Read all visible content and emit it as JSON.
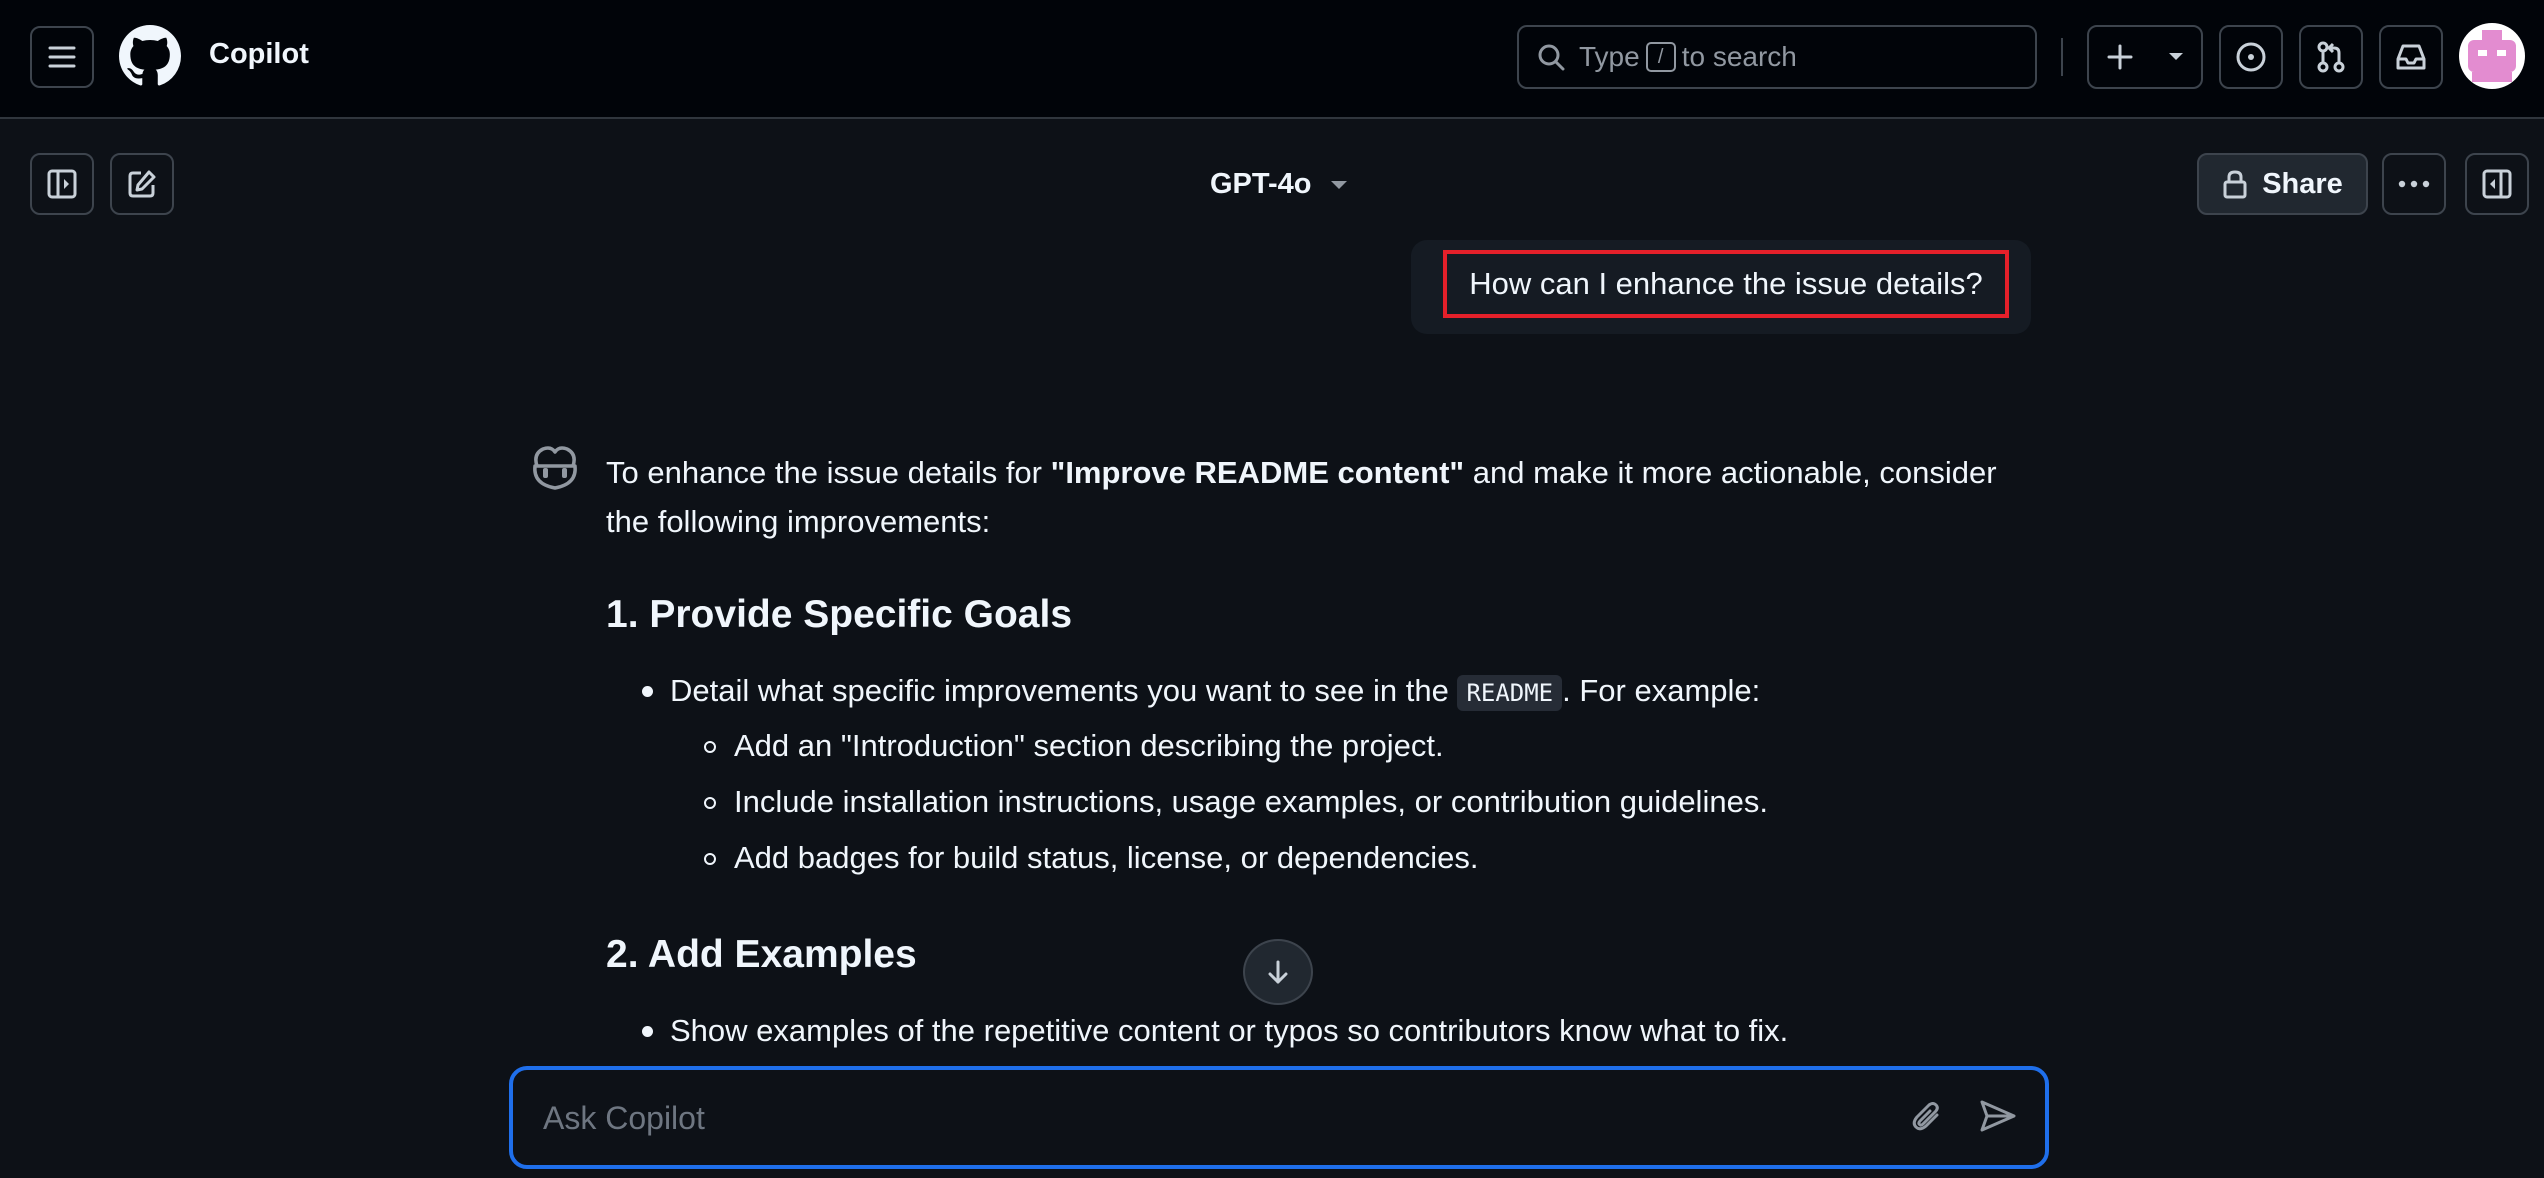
{
  "header": {
    "app_title": "Copilot",
    "search": {
      "prefix": "Type",
      "key_hint": "/",
      "suffix": "to search"
    },
    "icons": [
      "hamburger-icon",
      "github-logo",
      "search-icon",
      "plus-icon",
      "chevron-down-icon",
      "issue-opened-icon",
      "pull-request-icon",
      "inbox-icon",
      "avatar"
    ]
  },
  "toolbar": {
    "model": "GPT-4o",
    "share_label": "Share",
    "icons": [
      "sidebar-expand-icon",
      "new-chat-icon",
      "triangle-down-icon",
      "lock-icon",
      "kebab-horizontal-icon",
      "sidebar-collapse-icon"
    ]
  },
  "conversation": {
    "user_message": "How can I enhance the issue details?",
    "answer": {
      "intro_before": "To enhance the issue details for ",
      "intro_bold": "\"Improve README content\"",
      "intro_after": " and make it more actionable, consider the following improvements:",
      "section1_heading": "1. Provide Specific Goals",
      "section1_bullet_before": "Detail what specific improvements you want to see in the ",
      "section1_bullet_code": "README",
      "section1_bullet_after": ". For example:",
      "section1_subitems": [
        "Add an \"Introduction\" section describing the project.",
        "Include installation instructions, usage examples, or contribution guidelines.",
        "Add badges for build status, license, or dependencies."
      ],
      "section2_heading": "2. Add Examples",
      "section2_bullet": "Show examples of the repetitive content or typos so contributors know what to fix."
    }
  },
  "composer": {
    "placeholder": "Ask Copilot",
    "value": "",
    "icons": [
      "paperclip-icon",
      "paper-airplane-icon",
      "arrow-down-icon"
    ]
  },
  "colors": {
    "header_bg": "#010409",
    "page_bg": "#0d1117",
    "accent_focus": "#1f6feb",
    "highlight_box": "#e5202a",
    "avatar_pink": "#e38cd0"
  }
}
